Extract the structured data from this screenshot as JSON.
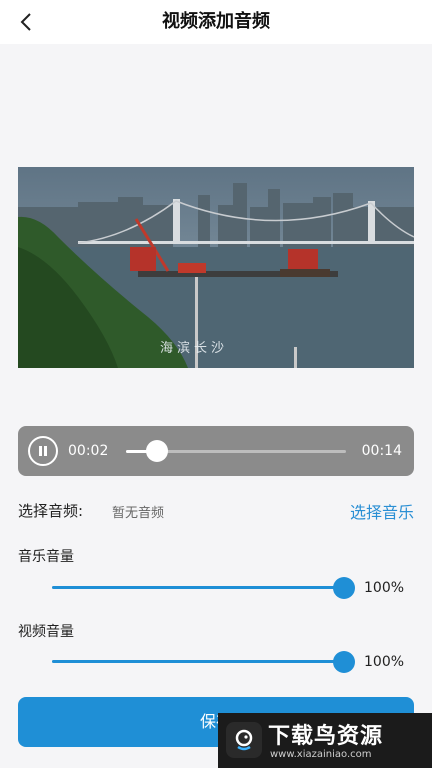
{
  "header": {
    "title": "视频添加音频",
    "back_icon": "back-arrow-icon"
  },
  "video": {
    "caption": "海滨长沙"
  },
  "player": {
    "state_icon": "pause-icon",
    "current_time": "00:02",
    "total_time": "00:14",
    "progress": 0.14
  },
  "audio": {
    "label": "选择音频:",
    "value": "暂无音频",
    "select_link": "选择音乐"
  },
  "music_volume": {
    "label": "音乐音量",
    "percent_text": "100%",
    "level": 1.0
  },
  "video_volume": {
    "label": "视频音量",
    "percent_text": "100%",
    "level": 1.0
  },
  "save_button": {
    "label": "保存"
  },
  "watermark": {
    "title": "下载鸟资源",
    "url": "www.xiazainiao.com"
  },
  "colors": {
    "accent": "#1f8fd6",
    "player_bg": "#8b8b8b",
    "page_bg": "#f5f5f7"
  }
}
